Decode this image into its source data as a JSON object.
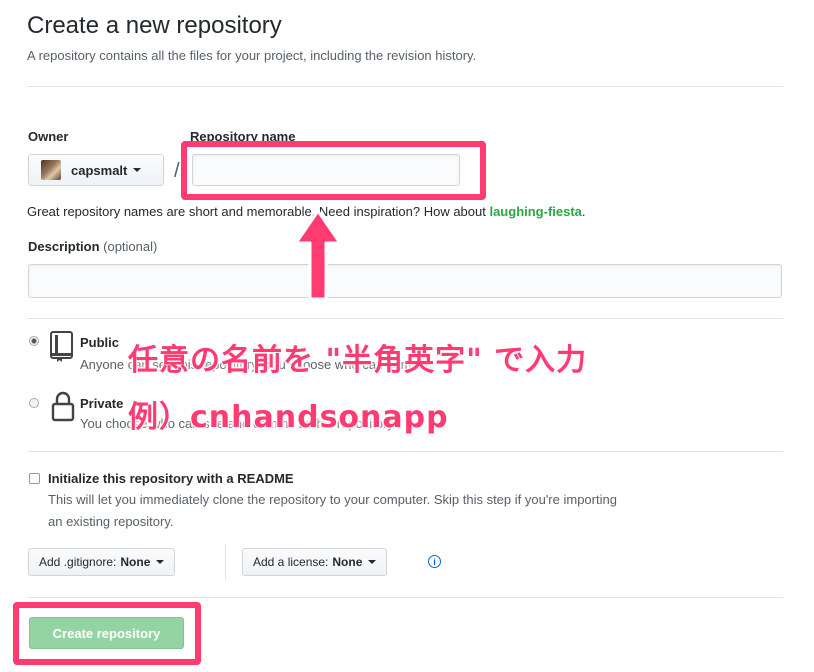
{
  "header": {
    "title": "Create a new repository",
    "subtitle": "A repository contains all the files for your project, including the revision history."
  },
  "owner": {
    "label": "Owner",
    "value": "capsmalt"
  },
  "repo_name": {
    "label": "Repository name",
    "value": "",
    "placeholder": ""
  },
  "name_hint": {
    "text": "Great repository names are short and memorable. Need inspiration? How about ",
    "suggestion": "laughing-fiesta",
    "suffix": "."
  },
  "description": {
    "label": "Description",
    "optional": "(optional)",
    "value": ""
  },
  "visibility": {
    "public_label": "Public",
    "public_desc": "Anyone can see this repository. You choose who can commit.",
    "private_label": "Private",
    "private_desc": "You choose who can see and commit to this repository.",
    "selected": "public"
  },
  "readme": {
    "label": "Initialize this repository with a README",
    "desc_line1": "This will let you immediately clone the repository to your computer. Skip this step if you're importing",
    "desc_line2": "an existing repository.",
    "checked": false
  },
  "gitignore": {
    "label": "Add .gitignore:",
    "value": "None"
  },
  "license": {
    "label": "Add a license:",
    "value": "None"
  },
  "create_button": {
    "label": "Create repository",
    "enabled": false
  },
  "annotation": {
    "line1": "任意の名前を \"半角英字\" で入力",
    "line2": "例）cnhandsonapp",
    "color": "#ff3b72"
  },
  "icons": [
    "chevron-down-icon",
    "public-repo-icon",
    "lock-icon",
    "info-icon",
    "arrow-up-icon"
  ]
}
